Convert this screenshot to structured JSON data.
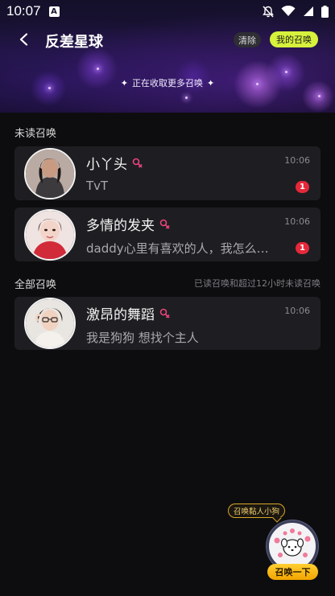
{
  "status_bar": {
    "time": "10:07",
    "notif_letter": "A"
  },
  "nav": {
    "title": "反差星球",
    "clear_label": "清除",
    "my_summon_label": "我的召唤"
  },
  "banner": {
    "text": "正在收取更多召唤",
    "star": "✦"
  },
  "unread": {
    "title": "未读召唤",
    "items": [
      {
        "name": "小丫头",
        "time": "10:06",
        "preview": "TvT",
        "badge": "1"
      },
      {
        "name": "多情的发夹",
        "time": "10:06",
        "preview": "daddy心里有喜欢的人，我怎么…",
        "badge": "1"
      }
    ]
  },
  "all": {
    "title": "全部召唤",
    "note": "已读召唤和超过12小时未读召唤",
    "items": [
      {
        "name": "激昂的舞蹈",
        "time": "10:06",
        "preview": "我是狗狗 想找个主人"
      }
    ]
  },
  "floating": {
    "bubble": "召唤黏人小狗",
    "button": "召唤一下"
  },
  "colors": {
    "accent_lime": "#d7f23c",
    "badge_red": "#e6283a",
    "gender_pink": "#e8457a",
    "gold": "#f3a500"
  },
  "icons": [
    "back-arrow-icon",
    "female-gender-icon",
    "mute-bell-icon",
    "wifi-icon",
    "signal-icon",
    "battery-icon"
  ]
}
